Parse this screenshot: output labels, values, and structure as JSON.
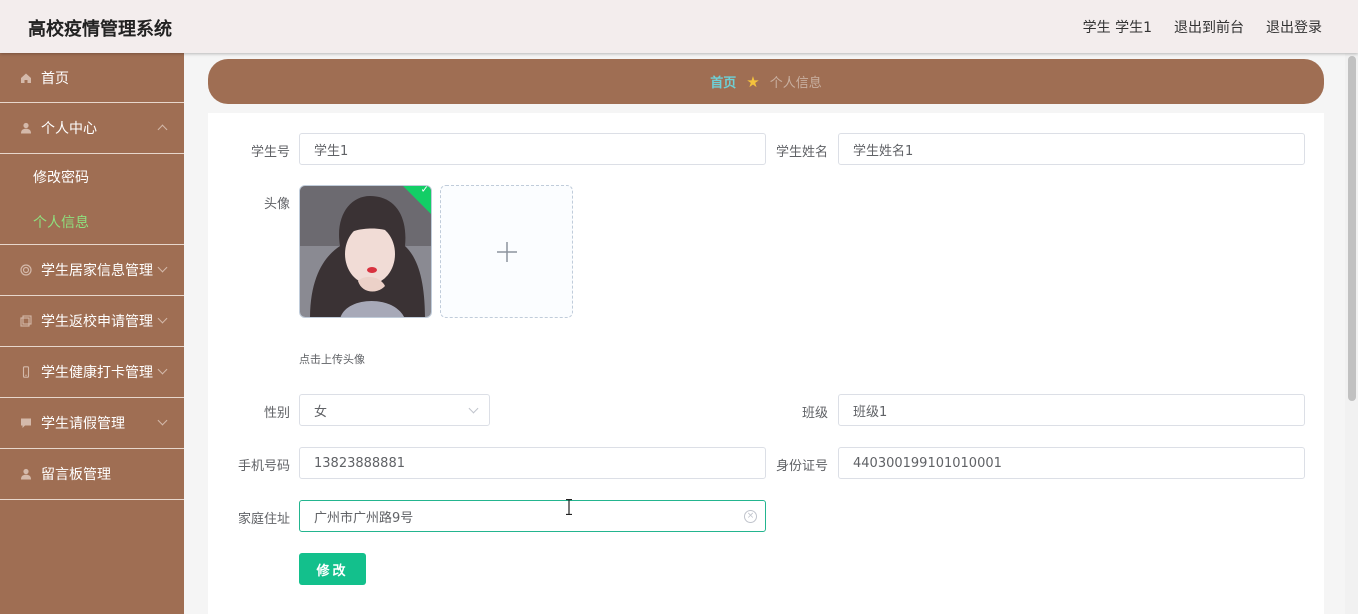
{
  "header": {
    "title": "高校疫情管理系统",
    "user_label": "学生 学生1",
    "to_front_label": "退出到前台",
    "logout_label": "退出登录"
  },
  "sidebar": {
    "home": "首页",
    "personal_center": "个人中心",
    "change_password": "修改密码",
    "personal_info": "个人信息",
    "items": [
      {
        "label": "学生居家信息管理",
        "icon": "home-info-icon"
      },
      {
        "label": "学生返校申请管理",
        "icon": "document-icon"
      },
      {
        "label": "学生健康打卡管理",
        "icon": "phone-icon"
      },
      {
        "label": "学生请假管理",
        "icon": "chat-icon"
      },
      {
        "label": "留言板管理",
        "icon": "user-icon"
      }
    ]
  },
  "breadcrumb": {
    "home": "首页",
    "current": "个人信息"
  },
  "form": {
    "student_no_label": "学生号",
    "student_no_value": "学生1",
    "student_name_label": "学生姓名",
    "student_name_value": "学生姓名1",
    "avatar_label": "头像",
    "upload_tip": "点击上传头像",
    "gender_label": "性别",
    "gender_value": "女",
    "class_label": "班级",
    "class_value": "班级1",
    "phone_label": "手机号码",
    "phone_value": "13823888881",
    "id_card_label": "身份证号",
    "id_card_value": "440300199101010001",
    "address_label": "家庭住址",
    "address_value": "广州市广州路9号",
    "submit_label": "修改"
  },
  "colors": {
    "sidebar_bg": "#9f6e53",
    "breadcrumb_bg": "#9f6e53",
    "accent_green": "#13c08c",
    "active_menu": "#8ee07e"
  }
}
